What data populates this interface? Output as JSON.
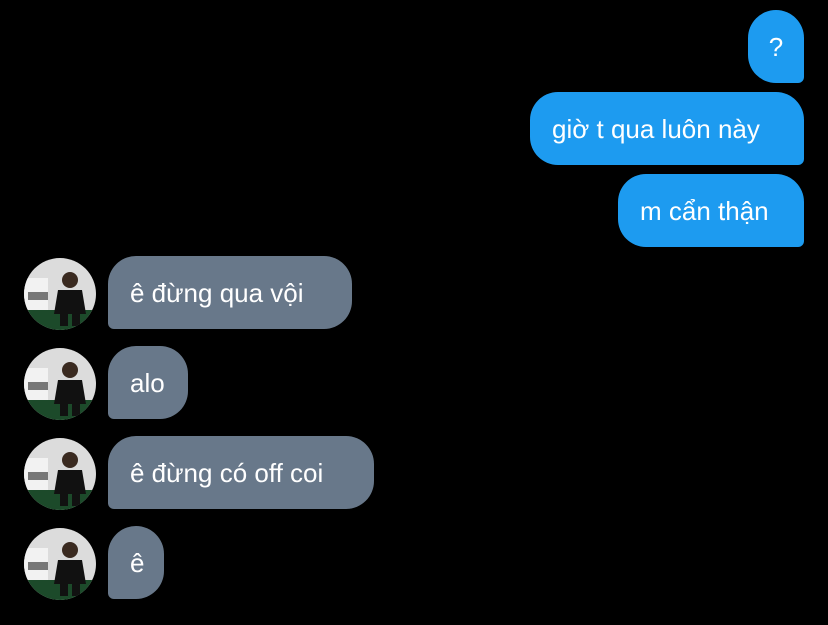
{
  "conversation": {
    "sent_messages": [
      {
        "text": "?"
      },
      {
        "text": "giờ t qua luôn này"
      },
      {
        "text": "m cẩn thận"
      }
    ],
    "received_messages": [
      {
        "text": "ê đừng qua vội",
        "avatar": "contact-avatar"
      },
      {
        "text": "alo",
        "avatar": "contact-avatar"
      },
      {
        "text": "ê đừng có off coi",
        "avatar": "contact-avatar"
      },
      {
        "text": "ê",
        "avatar": "contact-avatar"
      }
    ]
  },
  "colors": {
    "background": "#000000",
    "sent_bubble": "#1d9bf0",
    "received_bubble": "#68788a",
    "text": "#ffffff"
  }
}
